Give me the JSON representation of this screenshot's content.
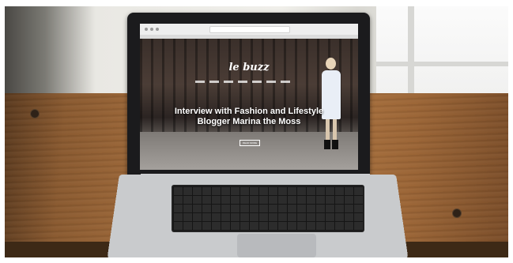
{
  "scene": {
    "description_icon": "laptop-on-wooden-desk",
    "colors": {
      "desk": "#a06a3a",
      "laptop_body": "#c9cbcd",
      "screen_bezel": "#1b1b1d"
    }
  },
  "screen": {
    "logo": "le buzz",
    "headline": "Interview with Fashion and Lifestyle Blogger Marina the Moss",
    "button": "READ MORE"
  }
}
